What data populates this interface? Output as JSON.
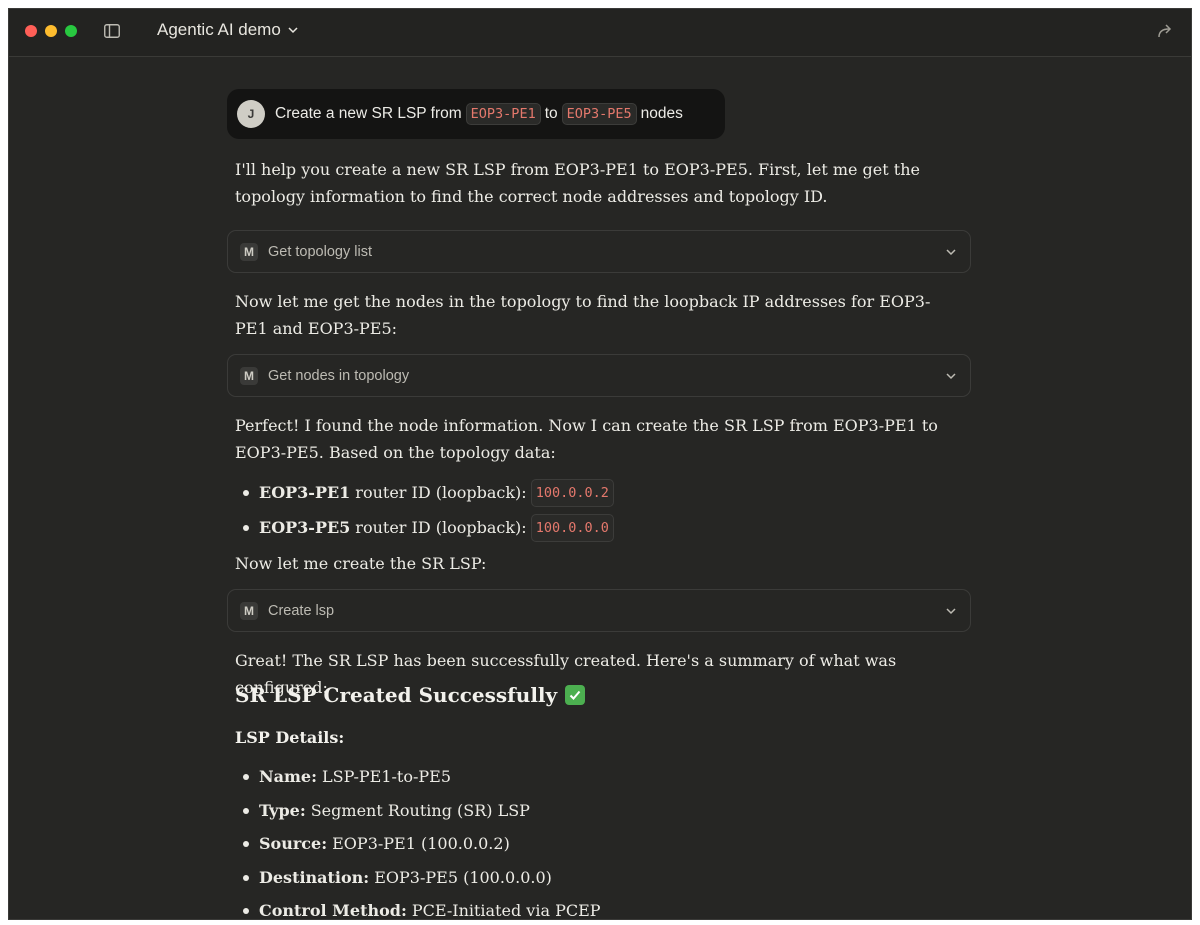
{
  "window": {
    "title": "Agentic AI demo"
  },
  "user_message": {
    "avatar_initial": "J",
    "text_before": "Create a new SR LSP from",
    "code1": "EOP3-PE1",
    "text_mid": "to",
    "code2": "EOP3-PE5",
    "text_after": "nodes"
  },
  "messages": {
    "p1": "I'll help you create a new SR LSP from EOP3-PE1 to EOP3-PE5. First, let me get the topology information to find the correct node addresses and topology ID.",
    "tool1": {
      "badge": "M",
      "label": "Get topology list"
    },
    "p2": "Now let me get the nodes in the topology to find the loopback IP addresses for EOP3-PE1 and EOP3-PE5:",
    "tool2": {
      "badge": "M",
      "label": "Get nodes in topology"
    },
    "p3": "Perfect! I found the node information. Now I can create the SR LSP from EOP3-PE1 to EOP3-PE5. Based on the topology data:",
    "router_bullets": [
      {
        "name": "EOP3-PE1",
        "text": "router ID (loopback):",
        "ip": "100.0.0.2"
      },
      {
        "name": "EOP3-PE5",
        "text": "router ID (loopback):",
        "ip": "100.0.0.0"
      }
    ],
    "p4": "Now let me create the SR LSP:",
    "tool3": {
      "badge": "M",
      "label": "Create lsp"
    },
    "p5": "Great! The SR LSP has been successfully created. Here's a summary of what was configured:",
    "heading": "SR LSP Created Successfully",
    "details_heading": "LSP Details:",
    "details": [
      {
        "key": "Name:",
        "value": "LSP-PE1-to-PE5"
      },
      {
        "key": "Type:",
        "value": "Segment Routing (SR) LSP"
      },
      {
        "key": "Source:",
        "value": "EOP3-PE1 (100.0.0.2)"
      },
      {
        "key": "Destination:",
        "value": "EOP3-PE5 (100.0.0.0)"
      },
      {
        "key": "Control Method:",
        "value": "PCE-Initiated via PCEP"
      }
    ]
  },
  "icons": [
    "sidebar-toggle-icon",
    "chevron-down-icon",
    "share-icon",
    "check-icon"
  ]
}
